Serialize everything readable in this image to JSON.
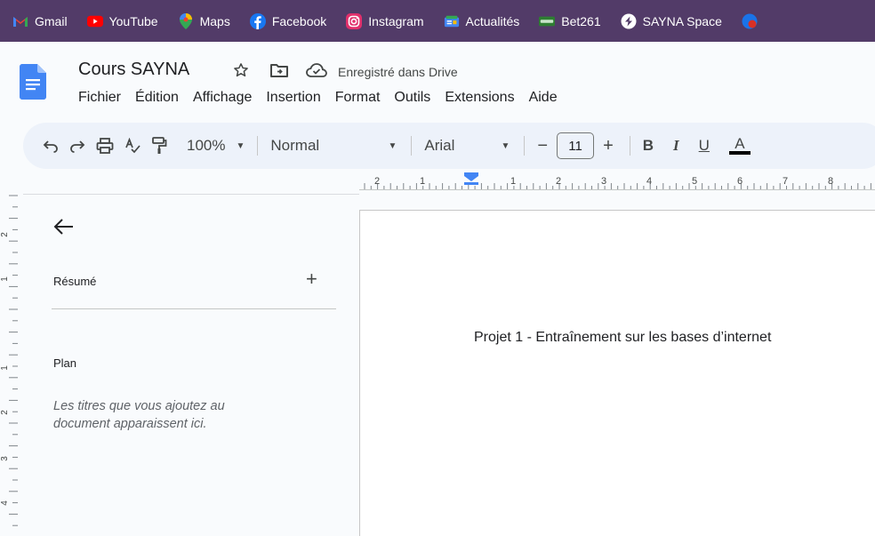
{
  "bookmarks": [
    {
      "label": "Gmail",
      "icon": "gmail-icon",
      "color": "#ea4335"
    },
    {
      "label": "YouTube",
      "icon": "youtube-icon",
      "color": "#ff0000"
    },
    {
      "label": "Maps",
      "icon": "maps-icon",
      "color": "#34a853"
    },
    {
      "label": "Facebook",
      "icon": "facebook-icon",
      "color": "#1877f2"
    },
    {
      "label": "Instagram",
      "icon": "instagram-icon",
      "color": "#e1306c"
    },
    {
      "label": "Actualités",
      "icon": "news-icon",
      "color": "#4285f4"
    },
    {
      "label": "Bet261",
      "icon": "bet261-icon",
      "color": "#2e7d32"
    },
    {
      "label": "SAYNA Space",
      "icon": "sayna-icon",
      "color": "#ffffff"
    }
  ],
  "document": {
    "title": "Cours SAYNA",
    "saved_status": "Enregistré dans Drive"
  },
  "menu": [
    "Fichier",
    "Édition",
    "Affichage",
    "Insertion",
    "Format",
    "Outils",
    "Extensions",
    "Aide"
  ],
  "toolbar": {
    "zoom": "100%",
    "style": "Normal",
    "font": "Arial",
    "font_size": "11",
    "minus": "−",
    "plus": "+",
    "bold": "B",
    "italic": "I",
    "underline": "U",
    "text_color": "A"
  },
  "ruler": {
    "horizontal_labels": [
      "2",
      "1",
      "1",
      "2",
      "3",
      "4",
      "5",
      "6",
      "7",
      "8"
    ],
    "vertical_labels": [
      "2",
      "1",
      "1",
      "2",
      "3",
      "4"
    ]
  },
  "sidebar": {
    "summary_label": "Résumé",
    "add_symbol": "+",
    "plan_label": "Plan",
    "plan_hint": "Les titres que vous ajoutez au document apparaissent ici."
  },
  "page": {
    "text": "Projet 1 - Entraînement sur les bases d’internet"
  },
  "colors": {
    "bookmarks_bg": "#523b68",
    "toolbar_bg": "#edf2fa",
    "app_bg": "#f9fbfd",
    "docs_blue": "#4285f4"
  }
}
